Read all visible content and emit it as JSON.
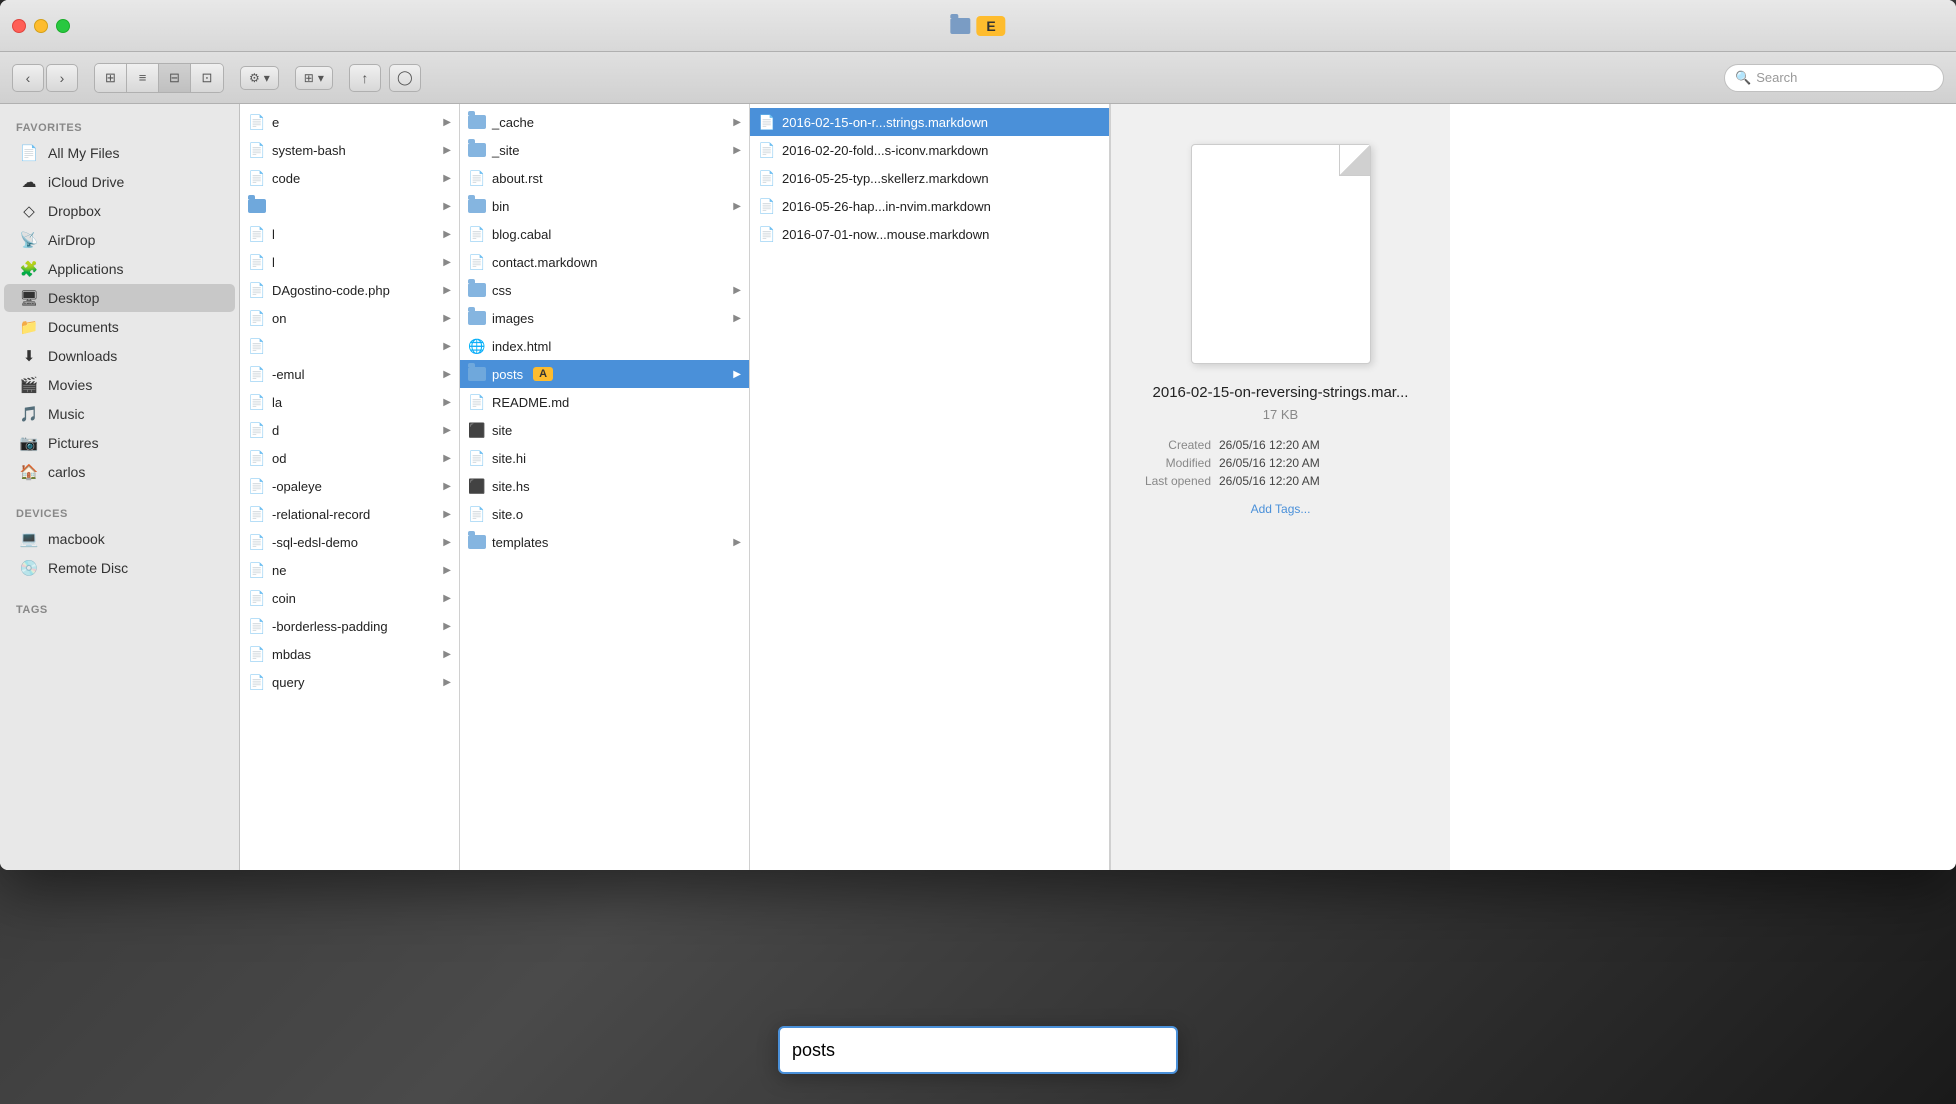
{
  "window": {
    "title": "E",
    "titleFolder": "folder-icon"
  },
  "toolbar": {
    "back_label": "‹",
    "forward_label": "›",
    "view_icons_label": "⊞",
    "view_list_label": "≡",
    "view_columns_label": "⊟",
    "view_cover_label": "⊡",
    "action_label": "⚙",
    "arrange_label": "⊞",
    "share_label": "↑",
    "tag_label": "◯",
    "search_placeholder": "Search"
  },
  "sidebar": {
    "favorites_label": "Favorites",
    "items": [
      {
        "id": "all-my-files",
        "label": "All My Files",
        "icon": "📄"
      },
      {
        "id": "icloud-drive",
        "label": "iCloud Drive",
        "icon": "☁"
      },
      {
        "id": "dropbox",
        "label": "Dropbox",
        "icon": "◇"
      },
      {
        "id": "airdrop",
        "label": "AirDrop",
        "icon": "📡"
      },
      {
        "id": "applications",
        "label": "Applications",
        "icon": "🧩"
      },
      {
        "id": "desktop",
        "label": "Desktop",
        "icon": "🖥",
        "active": true
      },
      {
        "id": "documents",
        "label": "Documents",
        "icon": "📁"
      },
      {
        "id": "downloads",
        "label": "Downloads",
        "icon": "⬇"
      },
      {
        "id": "movies",
        "label": "Movies",
        "icon": "🎬"
      },
      {
        "id": "music",
        "label": "Music",
        "icon": "🎵"
      },
      {
        "id": "pictures",
        "label": "Pictures",
        "icon": "📷"
      },
      {
        "id": "carlos",
        "label": "carlos",
        "icon": "🏠"
      }
    ],
    "devices_label": "Devices",
    "devices": [
      {
        "id": "macbook",
        "label": "macbook",
        "icon": "💻"
      },
      {
        "id": "remote-disc",
        "label": "Remote Disc",
        "icon": "💿"
      }
    ],
    "tags_label": "Tags"
  },
  "col1": {
    "items": [
      {
        "id": "e-item",
        "label": "e",
        "type": "text",
        "hasArrow": true
      },
      {
        "id": "system-bash",
        "label": "system-bash",
        "type": "text",
        "hasArrow": true
      },
      {
        "id": "code",
        "label": "code",
        "type": "text",
        "hasArrow": true
      },
      {
        "id": "item4",
        "label": "",
        "type": "folder",
        "hasArrow": true
      },
      {
        "id": "item5",
        "label": "l",
        "type": "text",
        "hasArrow": true
      },
      {
        "id": "item6",
        "label": "l",
        "type": "text",
        "hasArrow": true
      },
      {
        "id": "dAgostino-code-php",
        "label": "DAgostino-code.php",
        "type": "text",
        "hasArrow": true
      },
      {
        "id": "item7",
        "label": "on",
        "type": "text",
        "hasArrow": true
      },
      {
        "id": "item8",
        "label": "",
        "type": "text",
        "hasArrow": true
      },
      {
        "id": "item-emul",
        "label": "-emul",
        "type": "text",
        "hasArrow": true
      },
      {
        "id": "item-la",
        "label": "la",
        "type": "text",
        "hasArrow": true
      },
      {
        "id": "item-d",
        "label": "d",
        "type": "text",
        "hasArrow": true
      },
      {
        "id": "item-od",
        "label": "od",
        "type": "text",
        "hasArrow": true
      },
      {
        "id": "item-opaleye",
        "label": "-opaleye",
        "type": "text",
        "hasArrow": true
      },
      {
        "id": "item-relational",
        "label": "-relational-record",
        "type": "text",
        "hasArrow": true
      },
      {
        "id": "item-sql",
        "label": "-sql-edsl-demo",
        "type": "text",
        "hasArrow": true
      },
      {
        "id": "item-ne",
        "label": "ne",
        "type": "text",
        "hasArrow": true
      },
      {
        "id": "item-coin",
        "label": "coin",
        "type": "text",
        "hasArrow": true
      },
      {
        "id": "item-borderless",
        "label": "-borderless-padding",
        "type": "text",
        "hasArrow": true
      },
      {
        "id": "item-mbdas",
        "label": "mbdas",
        "type": "text",
        "hasArrow": true
      },
      {
        "id": "item-query",
        "label": "query",
        "type": "text",
        "hasArrow": true
      }
    ]
  },
  "col2": {
    "items": [
      {
        "id": "cache",
        "label": "_cache",
        "type": "folder",
        "hasArrow": true
      },
      {
        "id": "site",
        "label": "_site",
        "type": "folder",
        "hasArrow": true
      },
      {
        "id": "about-rst",
        "label": "about.rst",
        "type": "file",
        "hasArrow": false
      },
      {
        "id": "bin",
        "label": "bin",
        "type": "folder",
        "hasArrow": true
      },
      {
        "id": "blog-cabal",
        "label": "blog.cabal",
        "type": "file",
        "hasArrow": false
      },
      {
        "id": "contact-md",
        "label": "contact.markdown",
        "type": "file",
        "hasArrow": false
      },
      {
        "id": "css",
        "label": "css",
        "type": "folder",
        "hasArrow": true
      },
      {
        "id": "images",
        "label": "images",
        "type": "folder",
        "hasArrow": true
      },
      {
        "id": "index-html",
        "label": "index.html",
        "type": "chrome",
        "hasArrow": false
      },
      {
        "id": "posts",
        "label": "posts",
        "type": "folder",
        "hasArrow": true,
        "selected": true,
        "badge": "A"
      },
      {
        "id": "readme-md",
        "label": "README.md",
        "type": "file",
        "hasArrow": false
      },
      {
        "id": "site-bin",
        "label": "site",
        "type": "binary",
        "hasArrow": false
      },
      {
        "id": "site-hi",
        "label": "site.hi",
        "type": "file",
        "hasArrow": false
      },
      {
        "id": "site-hs",
        "label": "site.hs",
        "type": "binary",
        "hasArrow": false
      },
      {
        "id": "site-o",
        "label": "site.o",
        "type": "file",
        "hasArrow": false
      },
      {
        "id": "templates",
        "label": "templates",
        "type": "folder",
        "hasArrow": true
      }
    ]
  },
  "col3": {
    "items": [
      {
        "id": "file1",
        "label": "2016-02-15-on-r...strings.markdown",
        "type": "file",
        "selected": true
      },
      {
        "id": "file2",
        "label": "2016-02-20-fold...s-iconv.markdown",
        "type": "file"
      },
      {
        "id": "file3",
        "label": "2016-05-25-typ...skellerz.markdown",
        "type": "file"
      },
      {
        "id": "file4",
        "label": "2016-05-26-hap...in-nvim.markdown",
        "type": "file"
      },
      {
        "id": "file5",
        "label": "2016-07-01-now...mouse.markdown",
        "type": "file"
      }
    ]
  },
  "preview": {
    "name": "2016-02-15-on-reversing-strings.mar...",
    "size": "17 KB",
    "created_label": "Created",
    "created_value": "26/05/16 12:20 AM",
    "modified_label": "Modified",
    "modified_value": "26/05/16 12:20 AM",
    "last_opened_label": "Last opened",
    "last_opened_value": "26/05/16 12:20 AM",
    "add_tags_label": "Add Tags..."
  },
  "rename_input": {
    "value": "posts",
    "placeholder": "posts"
  }
}
